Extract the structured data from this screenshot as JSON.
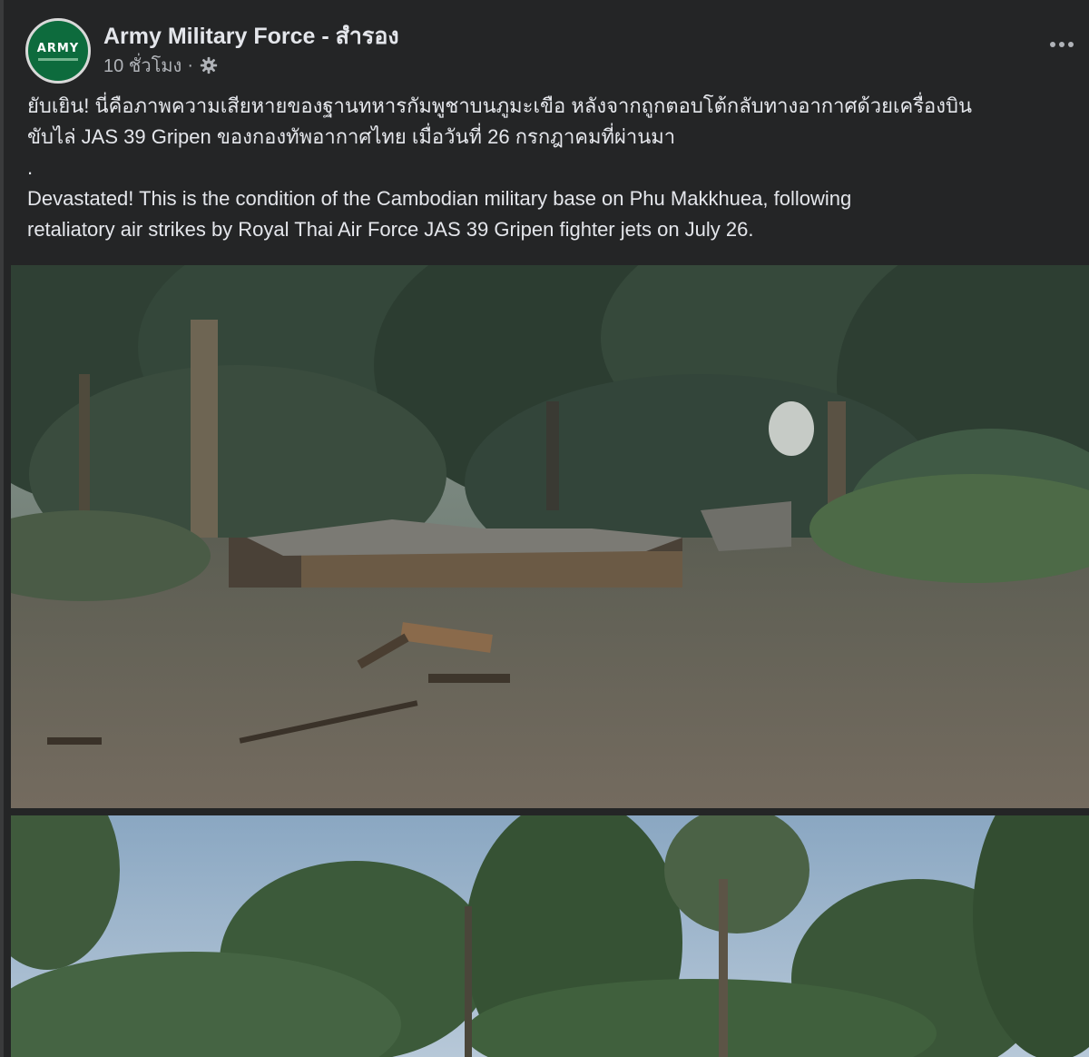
{
  "post": {
    "page_name": "Army Military Force - สำรอง",
    "time": "10 ชั่วโมง",
    "separator": "·",
    "avatar_text": "ARMY",
    "privacy_icon": "gear-icon",
    "more_icon": "more-options-icon",
    "text_thai_line1": "ยับเยิน! นี่คือภาพความเสียหายของฐานทหารกัมพูชาบนภูมะเขือ หลังจากถูกตอบโต้กลับทางอากาศด้วยเครื่องบิน",
    "text_thai_line2": "ขับไล่ JAS 39 Gripen ของกองทัพอากาศไทย เมื่อวันที่ 26 กรกฎาคมที่ผ่านมา",
    "text_dot": ".",
    "text_english_line1": "Devastated! This is the condition of the Cambodian military base on Phu Makkhuea, following",
    "text_english_line2": "retaliatory air strikes by Royal Thai Air Force JAS 39 Gripen fighter jets on July 26."
  },
  "colors": {
    "background": "#242526",
    "text": "#e4e6eb",
    "secondary_text": "#b0b3b8",
    "avatar_green": "#0d6b3d"
  }
}
